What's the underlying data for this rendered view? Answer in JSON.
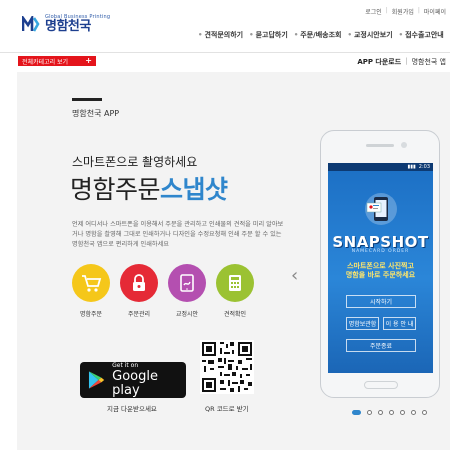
{
  "header": {
    "top_links": [
      "로그인",
      "회원가입",
      "마이페이"
    ],
    "logo_tagline": "Global Business Printing",
    "logo_name": "명함천국",
    "gnb": [
      "견적문의하기",
      "묻고답하기",
      "주문/배송조회",
      "교정시안보기",
      "접수출고안내"
    ]
  },
  "subbar": {
    "category_button": "전체카테고리 보기",
    "links": [
      "APP 다운로드",
      "명함천국 앱"
    ]
  },
  "main": {
    "section_title": "명함천국 APP",
    "headline_sub": "스마트폰으로 촬영하세요",
    "headline_plain": "명함주문",
    "headline_accent": "스냅샷",
    "description": "언제 어디서나 스마트폰을 이용해서 주문을 관리하고 인쇄물의 견적을 미리 알아보거나 명함을 촬영해 그대로 인쇄하거나 디자인을 수정요청해 인쇄 주문 할 수 있는 명함천국 앱으로 편리하게 인쇄하세요",
    "features": [
      {
        "label": "명함주문",
        "icon": "cart-icon",
        "color": "#f5c71a"
      },
      {
        "label": "주문관리",
        "icon": "lock-icon",
        "color": "#e52a36"
      },
      {
        "label": "교정시안",
        "icon": "tablet-icon",
        "color": "#b44fb0"
      },
      {
        "label": "견적확인",
        "icon": "calculator-icon",
        "color": "#9bc232"
      }
    ],
    "google_play": {
      "small": "Get it on",
      "big": "Google play"
    },
    "google_play_caption": "지금 다운받으세요",
    "qr_caption": "QR 코드로 받기"
  },
  "phone": {
    "status_time": "2:03",
    "logo": "SNAPSHOT",
    "logo_sub": "NAMECARD ORDER",
    "promo_line1": "스마트폰으로 사진찍고",
    "promo_line2": "명함을 바로 주문하세요",
    "buttons": {
      "start": "시작하기",
      "box": "명함보관함",
      "guide": "이 용 안 내",
      "order_done": "주문종료"
    }
  },
  "colors": {
    "accent_blue": "#2f86cc",
    "brand_red": "#e4141b",
    "logo_blue": "#1d3f8f"
  }
}
